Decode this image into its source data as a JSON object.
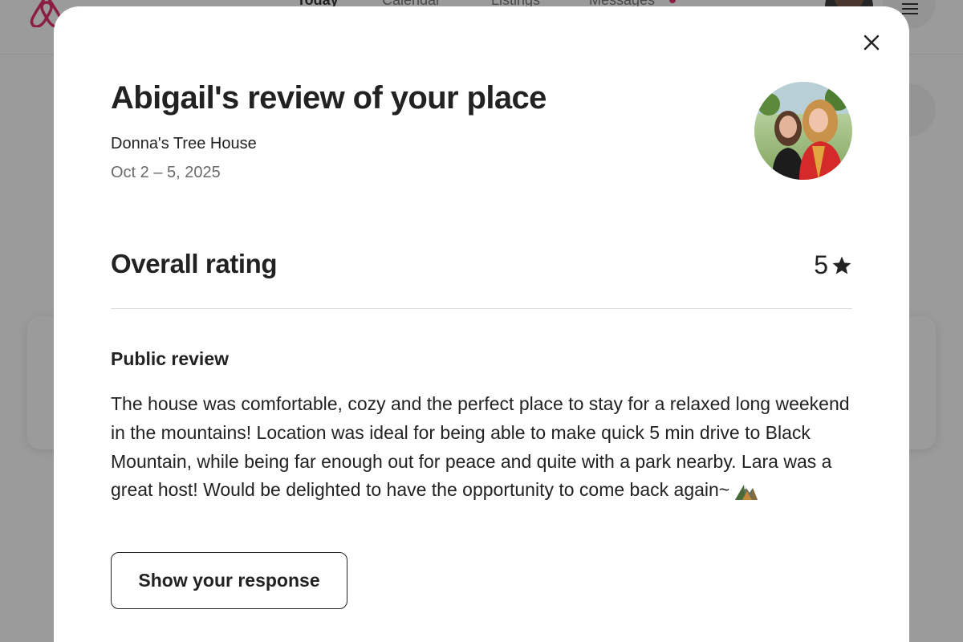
{
  "background": {
    "nav": {
      "today": "Today",
      "calendar": "Calendar",
      "listings": "Listings",
      "messages": "Messages"
    },
    "brand_color": "#e31c5f",
    "logo_icon": "airbnb-logo-icon",
    "menu_icon": "hamburger-menu-icon"
  },
  "modal": {
    "close_icon": "close-icon",
    "title": "Abigail's review of your place",
    "listing_name": "Donna's Tree House",
    "dates": "Oct 2 – 5, 2025",
    "reviewer_avatar_alt": "avatar",
    "rating": {
      "label": "Overall rating",
      "value": "5",
      "icon": "star-icon"
    },
    "public_review": {
      "label": "Public review",
      "text": "The house was comfortable, cozy and the perfect place to stay for a relaxed long weekend in the mountains! Location was ideal for being able to make quick 5 min drive to Black Mountain, while being far enough out for peace and quite with a park nearby. Lara was a great host! Would be delighted to have the opportunity to come back again~",
      "emoji_icon": "mountain-emoji-icon"
    },
    "show_response_button": "Show your response"
  }
}
